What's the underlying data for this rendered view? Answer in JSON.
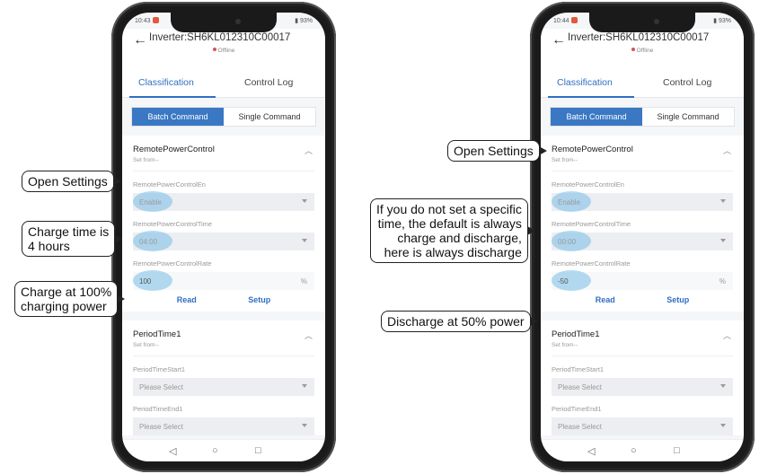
{
  "left": {
    "status": {
      "time": "10:43",
      "battery": "93%"
    },
    "header": {
      "back": "←",
      "title": "Inverter:SH6KL012310C00017",
      "status": "Offline"
    },
    "tabs": {
      "classification": "Classification",
      "control_log": "Control Log"
    },
    "segment": {
      "batch": "Batch Command",
      "single": "Single Command"
    },
    "remote": {
      "title": "RemotePowerControl",
      "set_from": "Set from--",
      "en_label": "RemotePowerControlEn",
      "en_value": "Enable",
      "time_label": "RemotePowerControlTime",
      "time_value": "04:00",
      "rate_label": "RemotePowerControlRate",
      "rate_value": "100",
      "rate_unit": "%",
      "read": "Read",
      "setup": "Setup"
    },
    "period": {
      "title": "PeriodTime1",
      "set_from": "Set from--",
      "start_label": "PeriodTimeStart1",
      "start_value": "Please Select",
      "end_label": "PeriodTimeEnd1",
      "end_value": "Please Select"
    }
  },
  "right": {
    "status": {
      "time": "10:44",
      "battery": "93%"
    },
    "header": {
      "back": "←",
      "title": "Inverter:SH6KL012310C00017",
      "status": "Offline"
    },
    "tabs": {
      "classification": "Classification",
      "control_log": "Control Log"
    },
    "segment": {
      "batch": "Batch Command",
      "single": "Single Command"
    },
    "remote": {
      "title": "RemotePowerControl",
      "set_from": "Set from--",
      "en_label": "RemotePowerControlEn",
      "en_value": "Enable",
      "time_label": "RemotePowerControlTime",
      "time_value": "00:00",
      "rate_label": "RemotePowerControlRate",
      "rate_value": "-50",
      "rate_unit": "%",
      "read": "Read",
      "setup": "Setup"
    },
    "period": {
      "title": "PeriodTime1",
      "set_from": "Set from--",
      "start_label": "PeriodTimeStart1",
      "start_value": "Please Select",
      "end_label": "PeriodTimeEnd1",
      "end_value": "Please Select"
    }
  },
  "callouts": {
    "left_open": "Open Settings",
    "left_charge_time": "Charge time is\n4 hours",
    "left_charge_power": "Charge at 100%\ncharging power",
    "right_open": "Open Settings",
    "right_default": "If you do not set a specific\ntime, the default is always\ncharge and discharge,\nhere is always discharge",
    "right_discharge": "Discharge at 50% power"
  },
  "colors": {
    "accent": "#2f6fc2",
    "highlight": "#78bee6",
    "offline_dot": "#e05050"
  }
}
